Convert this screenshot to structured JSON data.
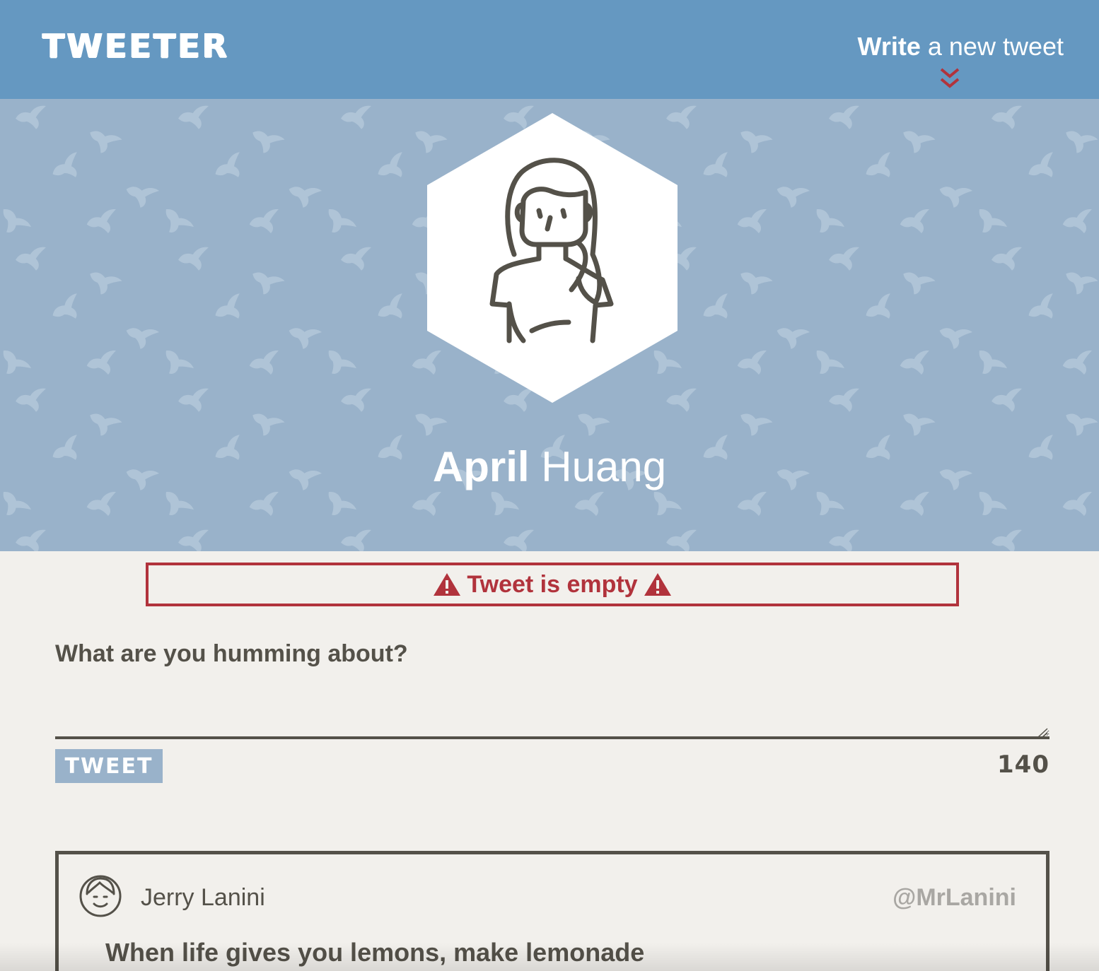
{
  "nav": {
    "brand": "TWEETER",
    "compose_toggle": {
      "strong": "Write",
      "light": "a new tweet"
    },
    "chevron_icon": "double-chevron-down-icon",
    "accent_color": "#b1333c"
  },
  "profile": {
    "first_name": "April",
    "last_name": "Huang",
    "avatar_icon": "woman-avatar-icon",
    "background_color": "#99b2ca"
  },
  "error": {
    "message": "Tweet is empty",
    "icon": "warning-icon",
    "color": "#b1333c"
  },
  "compose": {
    "label": "What are you humming about?",
    "value": "",
    "button_label": "TWEET",
    "counter": "140"
  },
  "tweets": [
    {
      "author": "Jerry Lanini",
      "handle": "@MrLanini",
      "text": "When life gives you lemons, make lemonade",
      "avatar_icon": "smiling-man-avatar-icon"
    }
  ],
  "colors": {
    "nav": "#6598c1",
    "page": "#f2f0ec",
    "text": "#545149",
    "handle": "#a9a7a3"
  }
}
